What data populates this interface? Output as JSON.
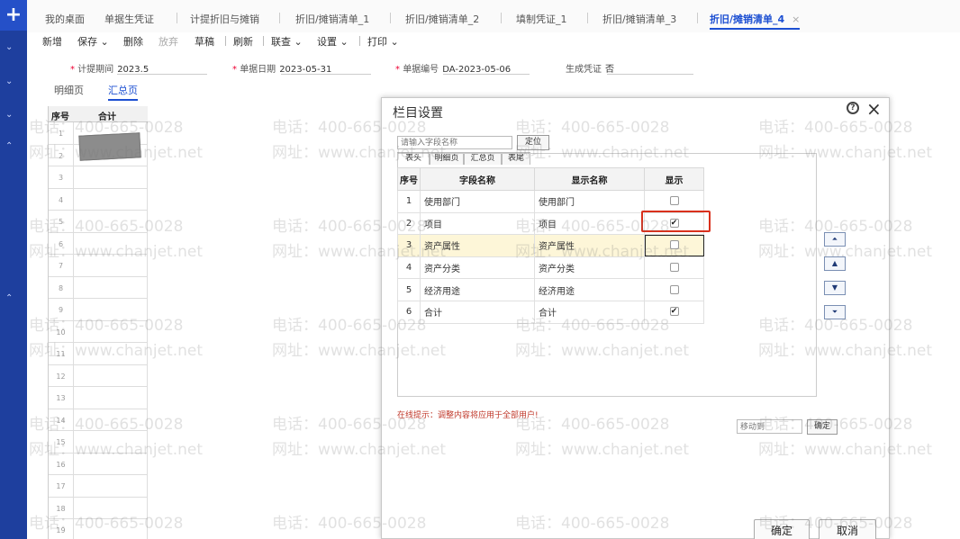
{
  "tabs": [
    {
      "label": "我的桌面"
    },
    {
      "label": "单据生凭证"
    },
    {
      "label": "计提折旧与摊销"
    },
    {
      "label": "折旧/摊销清单_1"
    },
    {
      "label": "折旧/摊销清单_2"
    },
    {
      "label": "填制凭证_1"
    },
    {
      "label": "折旧/摊销清单_3"
    },
    {
      "label": "折旧/摊销清单_4",
      "close": "×"
    }
  ],
  "toolbar": {
    "add": "新增",
    "save": "保存",
    "delete": "删除",
    "abandon": "放弃",
    "draft": "草稿",
    "refresh": "刷新",
    "link": "联查",
    "settings": "设置",
    "print": "打印"
  },
  "fields": {
    "period_label": "计提期间",
    "period_value": "2023.5",
    "date_label": "单据日期",
    "date_value": "2023-05-31",
    "doc_label": "单据编号",
    "doc_value": "DA-2023-05-06",
    "voucher_label": "生成凭证",
    "voucher_value": "否"
  },
  "subtabs": {
    "detail": "明细页",
    "summary": "汇总页"
  },
  "grid": {
    "col_no": "序号",
    "col_total": "合计",
    "rows": [
      "1",
      "2",
      "3",
      "4",
      "5",
      "6",
      "7",
      "8",
      "9",
      "10",
      "11",
      "12",
      "13",
      "14",
      "15",
      "16",
      "17",
      "18",
      "19"
    ]
  },
  "dialog": {
    "title": "栏目设置",
    "search_placeholder": "请输入字段名称",
    "locate_label": "定位",
    "pane_tabs": [
      "表头",
      "明细页",
      "汇总页",
      "表尾"
    ],
    "columns": {
      "no": "序号",
      "field": "字段名称",
      "display": "显示名称",
      "show": "显示"
    },
    "rows": [
      {
        "no": "1",
        "field": "使用部门",
        "display": "使用部门",
        "checked": false
      },
      {
        "no": "2",
        "field": "项目",
        "display": "项目",
        "checked": true
      },
      {
        "no": "3",
        "field": "资产属性",
        "display": "资产属性",
        "checked": false
      },
      {
        "no": "4",
        "field": "资产分类",
        "display": "资产分类",
        "checked": false
      },
      {
        "no": "5",
        "field": "经济用途",
        "display": "经济用途",
        "checked": false
      },
      {
        "no": "6",
        "field": "合计",
        "display": "合计",
        "checked": true
      }
    ],
    "tip": "在线提示：调整内容将应用于全部用户!",
    "move_to_placeholder": "移动到",
    "move_ok": "确定",
    "ok": "确定",
    "cancel": "取消"
  },
  "watermark": {
    "phone": "电话：400-665-0028",
    "site": "网址：www.chanjet.net"
  }
}
